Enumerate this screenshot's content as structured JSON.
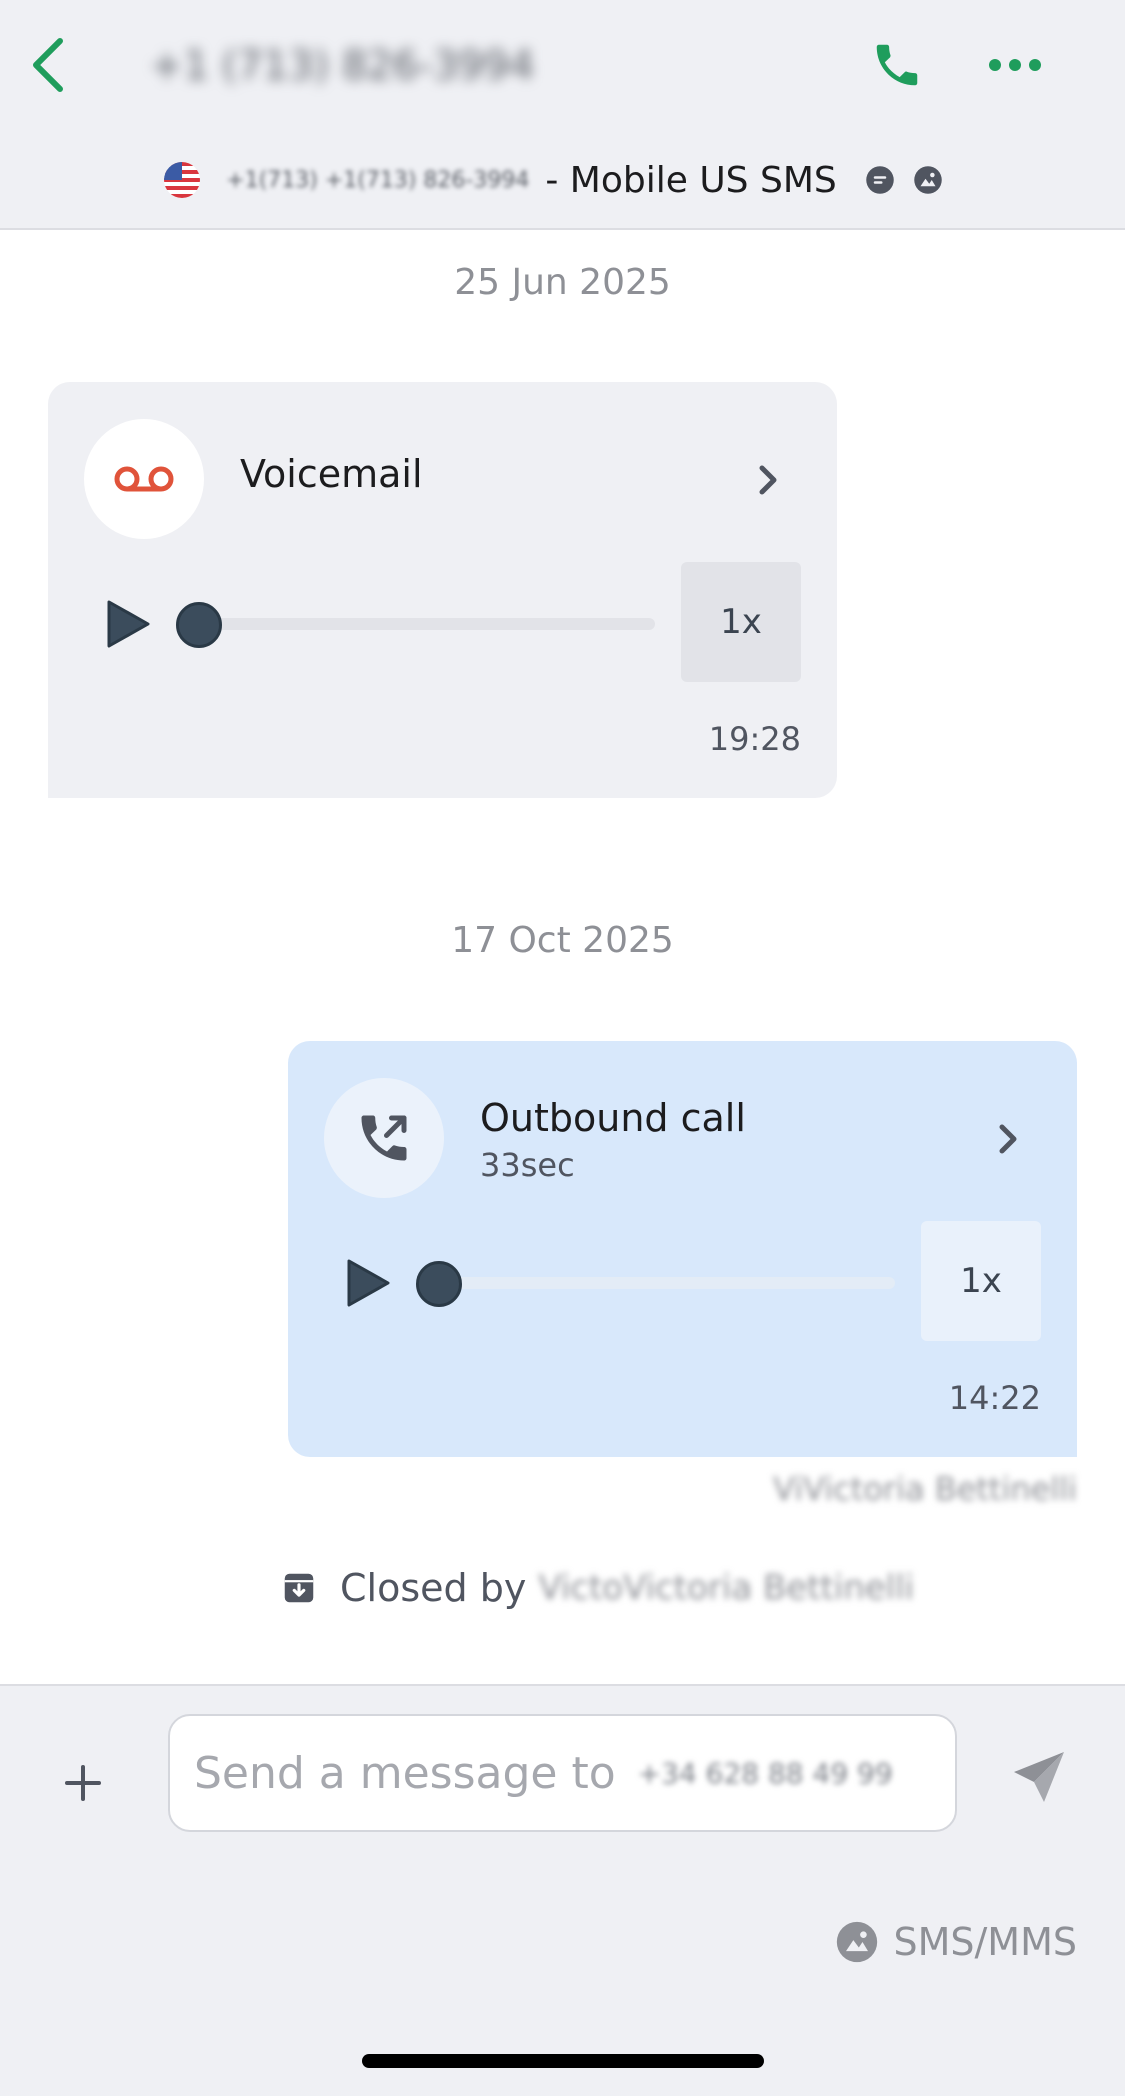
{
  "header": {
    "contact_name": "+1 (713) 826-3994",
    "sub_number": "+1(713) +1(713) 826-3994",
    "sub_label": "- Mobile US SMS"
  },
  "messages": {
    "date_1": "25 Jun 2025",
    "voicemail": {
      "title": "Voicemail",
      "speed": "1x",
      "time": "19:28",
      "progress": 0
    },
    "date_2": "17 Oct 2025",
    "outbound": {
      "title": "Outbound call",
      "duration": "33sec",
      "speed": "1x",
      "time": "14:22",
      "progress": 0
    },
    "agent_name": "ViVictoria Bettinelli",
    "closed_label": "Closed by",
    "closed_name": "VictoVictoria Bettinelli"
  },
  "composer": {
    "placeholder": "Send a message to",
    "recipient_number": "+34 628 88 49 99",
    "channel_label": "SMS/MMS"
  },
  "colors": {
    "accent_green": "#1f9d5c",
    "voicemail_red": "#e0533a",
    "outbound_bubble": "#d8e8fb",
    "inbound_bubble": "#eff0f4"
  }
}
